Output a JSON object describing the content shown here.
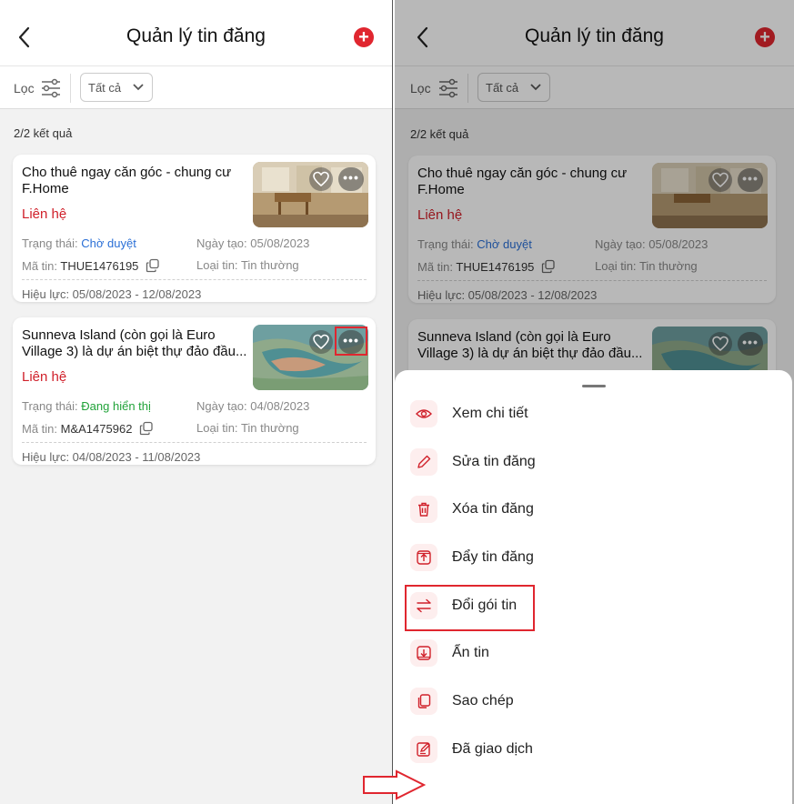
{
  "header": {
    "title": "Quản lý tin đăng"
  },
  "filter": {
    "label": "Lọc",
    "select_value": "Tất cả"
  },
  "results_text": "2/2 kết quả",
  "listings": [
    {
      "title_line1": "Cho thuê ngay căn góc - chung cư",
      "title_line2": "F.Home",
      "price": "Liên hệ",
      "status_label": "Trạng thái:",
      "status_value": "Chờ duyệt",
      "created_label": "Ngày tạo:",
      "created_value": "05/08/2023",
      "code_label": "Mã tin:",
      "code_value": "THUE1476195",
      "type_label": "Loại tin:",
      "type_value": "Tin thường",
      "validity": "Hiệu lực: 05/08/2023 - 12/08/2023"
    },
    {
      "title_line1": "Sunneva Island (còn gọi là Euro",
      "title_line2": "Village 3) là dự án biệt thự đảo đầu...",
      "price": "Liên hệ",
      "status_label": "Trạng thái:",
      "status_value": "Đang hiển thị",
      "created_label": "Ngày tạo:",
      "created_value": "04/08/2023",
      "code_label": "Mã tin:",
      "code_value": "M&A1475962",
      "type_label": "Loại tin:",
      "type_value": "Tin thường",
      "validity": "Hiệu lực: 04/08/2023 - 11/08/2023"
    }
  ],
  "menu": {
    "items": [
      {
        "label": "Xem chi tiết",
        "icon": "eye-icon"
      },
      {
        "label": "Sửa tin đăng",
        "icon": "pencil-icon"
      },
      {
        "label": "Xóa tin đăng",
        "icon": "trash-icon"
      },
      {
        "label": "Đẩy tin đăng",
        "icon": "push-up-icon"
      },
      {
        "label": "Đổi gói tin",
        "icon": "swap-icon"
      },
      {
        "label": "Ẩn tin",
        "icon": "hide-icon"
      },
      {
        "label": "Sao chép",
        "icon": "copy-icon"
      },
      {
        "label": "Đã giao dịch",
        "icon": "edit-note-icon"
      }
    ]
  },
  "colors": {
    "accent": "#e0262f",
    "status_pending": "#2a6fd6",
    "status_active": "#22a33a"
  }
}
